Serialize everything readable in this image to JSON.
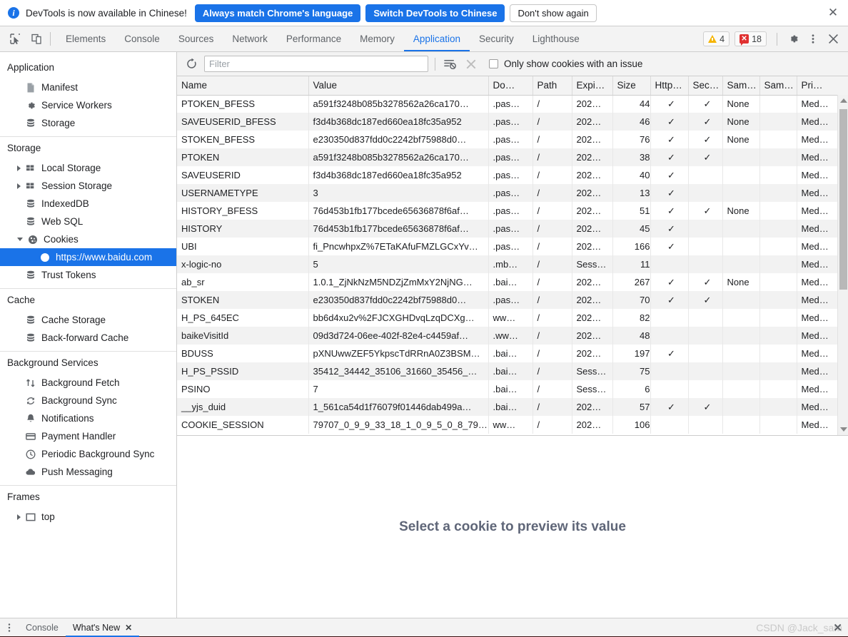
{
  "infobar": {
    "message": "DevTools is now available in Chinese!",
    "info_icon": "info-icon",
    "buttons": [
      {
        "label": "Always match Chrome's language",
        "style": "primary"
      },
      {
        "label": "Switch DevTools to Chinese",
        "style": "primary"
      },
      {
        "label": "Don't show again",
        "style": "secondary"
      }
    ],
    "close_label": "✕"
  },
  "tabbar": {
    "inspect_icon": "inspect-element-icon",
    "device_icon": "device-toolbar-icon",
    "tabs": [
      {
        "label": "Elements",
        "active": false
      },
      {
        "label": "Console",
        "active": false
      },
      {
        "label": "Sources",
        "active": false
      },
      {
        "label": "Network",
        "active": false
      },
      {
        "label": "Performance",
        "active": false
      },
      {
        "label": "Memory",
        "active": false
      },
      {
        "label": "Application",
        "active": true
      },
      {
        "label": "Security",
        "active": false
      },
      {
        "label": "Lighthouse",
        "active": false
      }
    ],
    "warnings_count": "4",
    "errors_count": "18",
    "settings_icon": "gear-icon",
    "more_icon": "kebab-menu-icon",
    "close_icon": "close-icon"
  },
  "sidebar": {
    "sections": [
      {
        "title": "Application",
        "items": [
          {
            "label": "Manifest",
            "icon": "manifest-document-icon",
            "indent": 1,
            "arrow": "none",
            "selected": false
          },
          {
            "label": "Service Workers",
            "icon": "gear-icon",
            "indent": 1,
            "arrow": "none",
            "selected": false
          },
          {
            "label": "Storage",
            "icon": "database-icon",
            "indent": 1,
            "arrow": "none",
            "selected": false
          }
        ]
      },
      {
        "title": "Storage",
        "items": [
          {
            "label": "Local Storage",
            "icon": "table-grid-icon",
            "indent": 1,
            "arrow": "closed",
            "selected": false
          },
          {
            "label": "Session Storage",
            "icon": "table-grid-icon",
            "indent": 1,
            "arrow": "closed",
            "selected": false
          },
          {
            "label": "IndexedDB",
            "icon": "database-icon",
            "indent": 1,
            "arrow": "none",
            "selected": false
          },
          {
            "label": "Web SQL",
            "icon": "database-icon",
            "indent": 1,
            "arrow": "none",
            "selected": false
          },
          {
            "label": "Cookies",
            "icon": "cookie-icon",
            "indent": 1,
            "arrow": "open",
            "selected": false
          },
          {
            "label": "https://www.baidu.com",
            "icon": "cookie-icon",
            "indent": 2,
            "arrow": "none",
            "selected": true
          },
          {
            "label": "Trust Tokens",
            "icon": "database-icon",
            "indent": 1,
            "arrow": "none",
            "selected": false
          }
        ]
      },
      {
        "title": "Cache",
        "items": [
          {
            "label": "Cache Storage",
            "icon": "database-icon",
            "indent": 1,
            "arrow": "none",
            "selected": false
          },
          {
            "label": "Back-forward Cache",
            "icon": "database-icon",
            "indent": 1,
            "arrow": "none",
            "selected": false
          }
        ]
      },
      {
        "title": "Background Services",
        "items": [
          {
            "label": "Background Fetch",
            "icon": "arrows-up-down-icon",
            "indent": 1,
            "arrow": "none",
            "selected": false
          },
          {
            "label": "Background Sync",
            "icon": "sync-icon",
            "indent": 1,
            "arrow": "none",
            "selected": false
          },
          {
            "label": "Notifications",
            "icon": "bell-icon",
            "indent": 1,
            "arrow": "none",
            "selected": false
          },
          {
            "label": "Payment Handler",
            "icon": "credit-card-icon",
            "indent": 1,
            "arrow": "none",
            "selected": false
          },
          {
            "label": "Periodic Background Sync",
            "icon": "clock-icon",
            "indent": 1,
            "arrow": "none",
            "selected": false
          },
          {
            "label": "Push Messaging",
            "icon": "cloud-icon",
            "indent": 1,
            "arrow": "none",
            "selected": false
          }
        ]
      },
      {
        "title": "Frames",
        "items": [
          {
            "label": "top",
            "icon": "frame-square-icon",
            "indent": 1,
            "arrow": "closed",
            "selected": false
          }
        ]
      }
    ]
  },
  "filterbar": {
    "refresh_icon": "refresh-icon",
    "filter_placeholder": "Filter",
    "filter_value": "",
    "clear_filtered_icon": "clear-filtered-cookies-icon",
    "clear_all_icon": "clear-all-cookies-icon",
    "checkbox_label": "Only show cookies with an issue",
    "checkbox_checked": false
  },
  "table": {
    "columns": [
      "Name",
      "Value",
      "Do…",
      "Path",
      "Expi…",
      "Size",
      "Http…",
      "Sec…",
      "Sam…",
      "Sam…",
      "Pri…"
    ],
    "rows": [
      {
        "name": "PTOKEN_BFESS",
        "value": "a591f3248b085b3278562a26ca170…",
        "domain": ".pas…",
        "path": "/",
        "expires": "202…",
        "size": "44",
        "httponly": "✓",
        "secure": "✓",
        "samesite": "None",
        "samesite2": "",
        "priority": "Med…"
      },
      {
        "name": "SAVEUSERID_BFESS",
        "value": "f3d4b368dc187ed660ea18fc35a952",
        "domain": ".pas…",
        "path": "/",
        "expires": "202…",
        "size": "46",
        "httponly": "✓",
        "secure": "✓",
        "samesite": "None",
        "samesite2": "",
        "priority": "Med…"
      },
      {
        "name": "STOKEN_BFESS",
        "value": "e230350d837fdd0c2242bf75988d0…",
        "domain": ".pas…",
        "path": "/",
        "expires": "202…",
        "size": "76",
        "httponly": "✓",
        "secure": "✓",
        "samesite": "None",
        "samesite2": "",
        "priority": "Med…"
      },
      {
        "name": "PTOKEN",
        "value": "a591f3248b085b3278562a26ca170…",
        "domain": ".pas…",
        "path": "/",
        "expires": "202…",
        "size": "38",
        "httponly": "✓",
        "secure": "✓",
        "samesite": "",
        "samesite2": "",
        "priority": "Med…"
      },
      {
        "name": "SAVEUSERID",
        "value": "f3d4b368dc187ed660ea18fc35a952",
        "domain": ".pas…",
        "path": "/",
        "expires": "202…",
        "size": "40",
        "httponly": "✓",
        "secure": "",
        "samesite": "",
        "samesite2": "",
        "priority": "Med…"
      },
      {
        "name": "USERNAMETYPE",
        "value": "3",
        "domain": ".pas…",
        "path": "/",
        "expires": "202…",
        "size": "13",
        "httponly": "✓",
        "secure": "",
        "samesite": "",
        "samesite2": "",
        "priority": "Med…"
      },
      {
        "name": "HISTORY_BFESS",
        "value": "76d453b1fb177bcede65636878f6af…",
        "domain": ".pas…",
        "path": "/",
        "expires": "202…",
        "size": "51",
        "httponly": "✓",
        "secure": "✓",
        "samesite": "None",
        "samesite2": "",
        "priority": "Med…"
      },
      {
        "name": "HISTORY",
        "value": "76d453b1fb177bcede65636878f6af…",
        "domain": ".pas…",
        "path": "/",
        "expires": "202…",
        "size": "45",
        "httponly": "✓",
        "secure": "",
        "samesite": "",
        "samesite2": "",
        "priority": "Med…"
      },
      {
        "name": "UBI",
        "value": "fi_PncwhpxZ%7ETaKAfuFMZLGCxYv…",
        "domain": ".pas…",
        "path": "/",
        "expires": "202…",
        "size": "166",
        "httponly": "✓",
        "secure": "",
        "samesite": "",
        "samesite2": "",
        "priority": "Med…"
      },
      {
        "name": "x-logic-no",
        "value": "5",
        "domain": ".mb…",
        "path": "/",
        "expires": "Sess…",
        "size": "11",
        "httponly": "",
        "secure": "",
        "samesite": "",
        "samesite2": "",
        "priority": "Med…"
      },
      {
        "name": "ab_sr",
        "value": "1.0.1_ZjNkNzM5NDZjZmMxY2NjNG…",
        "domain": ".bai…",
        "path": "/",
        "expires": "202…",
        "size": "267",
        "httponly": "✓",
        "secure": "✓",
        "samesite": "None",
        "samesite2": "",
        "priority": "Med…"
      },
      {
        "name": "STOKEN",
        "value": "e230350d837fdd0c2242bf75988d0…",
        "domain": ".pas…",
        "path": "/",
        "expires": "202…",
        "size": "70",
        "httponly": "✓",
        "secure": "✓",
        "samesite": "",
        "samesite2": "",
        "priority": "Med…"
      },
      {
        "name": "H_PS_645EC",
        "value": "bb6d4xu2v%2FJCXGHDvqLzqDCXg…",
        "domain": "ww…",
        "path": "/",
        "expires": "202…",
        "size": "82",
        "httponly": "",
        "secure": "",
        "samesite": "",
        "samesite2": "",
        "priority": "Med…"
      },
      {
        "name": "baikeVisitId",
        "value": "09d3d724-06ee-402f-82e4-c4459af…",
        "domain": ".ww…",
        "path": "/",
        "expires": "202…",
        "size": "48",
        "httponly": "",
        "secure": "",
        "samesite": "",
        "samesite2": "",
        "priority": "Med…"
      },
      {
        "name": "BDUSS",
        "value": "pXNUwwZEF5YkpscTdRRnA0Z3BSM…",
        "domain": ".bai…",
        "path": "/",
        "expires": "202…",
        "size": "197",
        "httponly": "✓",
        "secure": "",
        "samesite": "",
        "samesite2": "",
        "priority": "Med…"
      },
      {
        "name": "H_PS_PSSID",
        "value": "35412_34442_35106_31660_35456_…",
        "domain": ".bai…",
        "path": "/",
        "expires": "Sess…",
        "size": "75",
        "httponly": "",
        "secure": "",
        "samesite": "",
        "samesite2": "",
        "priority": "Med…"
      },
      {
        "name": "PSINO",
        "value": "7",
        "domain": ".bai…",
        "path": "/",
        "expires": "Sess…",
        "size": "6",
        "httponly": "",
        "secure": "",
        "samesite": "",
        "samesite2": "",
        "priority": "Med…"
      },
      {
        "name": "__yjs_duid",
        "value": "1_561ca54d1f76079f01446dab499a…",
        "domain": ".bai…",
        "path": "/",
        "expires": "202…",
        "size": "57",
        "httponly": "✓",
        "secure": "✓",
        "samesite": "",
        "samesite2": "",
        "priority": "Med…"
      },
      {
        "name": "COOKIE_SESSION",
        "value": "79707_0_9_9_33_18_1_0_9_5_0_8_79…",
        "domain": "ww…",
        "path": "/",
        "expires": "202…",
        "size": "106",
        "httponly": "",
        "secure": "",
        "samesite": "",
        "samesite2": "",
        "priority": "Med…"
      }
    ]
  },
  "preview": {
    "empty_text": "Select a cookie to preview its value"
  },
  "drawer": {
    "more_icon": "kebab-menu-icon",
    "tabs": [
      {
        "label": "Console",
        "active": false,
        "closable": false
      },
      {
        "label": "What's New",
        "active": true,
        "closable": true
      }
    ],
    "close_glyph": "✕",
    "watermark": "CSDN @Jack_sam"
  },
  "colors": {
    "accent": "#1a73e8",
    "selected_row": "#1a73e8",
    "warning": "#f5b400",
    "error": "#e03030",
    "check": "#c8632a"
  }
}
